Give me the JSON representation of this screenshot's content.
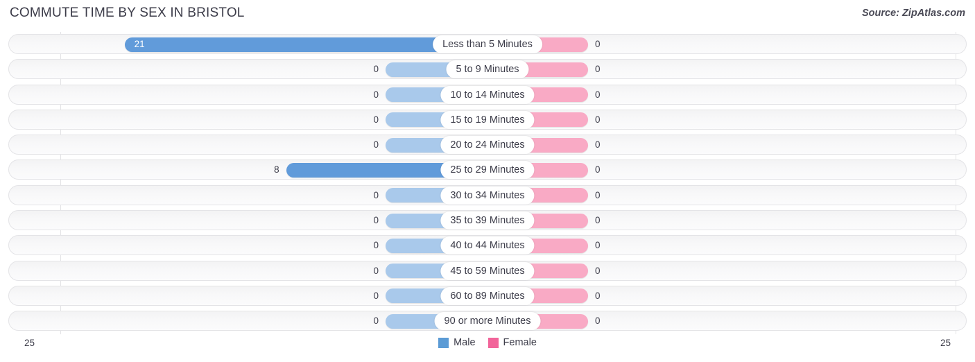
{
  "header": {
    "title": "COMMUTE TIME BY SEX IN BRISTOL",
    "source": "Source: ZipAtlas.com"
  },
  "axis": {
    "min_label": "25",
    "max_label": "25"
  },
  "legend": {
    "items": [
      {
        "label": "Male",
        "color": "#5b9bd5"
      },
      {
        "label": "Female",
        "color": "#f2649a"
      }
    ]
  },
  "chart_data": {
    "type": "bar",
    "orientation": "horizontal-diverging",
    "title": "COMMUTE TIME BY SEX IN BRISTOL",
    "subtitle": "",
    "source": "Source: ZipAtlas.com",
    "xlabel": "",
    "ylabel": "",
    "xlim": [
      25,
      25
    ],
    "axis_min": 25,
    "axis_max": 25,
    "grid": false,
    "legend_position": "bottom-center",
    "categories": [
      "Less than 5 Minutes",
      "5 to 9 Minutes",
      "10 to 14 Minutes",
      "15 to 19 Minutes",
      "20 to 24 Minutes",
      "25 to 29 Minutes",
      "30 to 34 Minutes",
      "35 to 39 Minutes",
      "40 to 44 Minutes",
      "45 to 59 Minutes",
      "60 to 89 Minutes",
      "90 or more Minutes"
    ],
    "series": [
      {
        "name": "Male",
        "color": "#5b9bd5",
        "side": "left",
        "values": [
          21,
          0,
          0,
          0,
          0,
          8,
          0,
          0,
          0,
          0,
          0,
          0
        ]
      },
      {
        "name": "Female",
        "color": "#f2649a",
        "side": "right",
        "values": [
          0,
          0,
          0,
          0,
          0,
          0,
          0,
          0,
          0,
          0,
          0,
          0
        ]
      }
    ]
  },
  "rows": [
    {
      "label": "Less than 5 Minutes",
      "male": "21",
      "female": "0"
    },
    {
      "label": "5 to 9 Minutes",
      "male": "0",
      "female": "0"
    },
    {
      "label": "10 to 14 Minutes",
      "male": "0",
      "female": "0"
    },
    {
      "label": "15 to 19 Minutes",
      "male": "0",
      "female": "0"
    },
    {
      "label": "20 to 24 Minutes",
      "male": "0",
      "female": "0"
    },
    {
      "label": "25 to 29 Minutes",
      "male": "8",
      "female": "0"
    },
    {
      "label": "30 to 34 Minutes",
      "male": "0",
      "female": "0"
    },
    {
      "label": "35 to 39 Minutes",
      "male": "0",
      "female": "0"
    },
    {
      "label": "40 to 44 Minutes",
      "male": "0",
      "female": "0"
    },
    {
      "label": "45 to 59 Minutes",
      "male": "0",
      "female": "0"
    },
    {
      "label": "60 to 89 Minutes",
      "male": "0",
      "female": "0"
    },
    {
      "label": "90 or more Minutes",
      "male": "0",
      "female": "0"
    }
  ]
}
